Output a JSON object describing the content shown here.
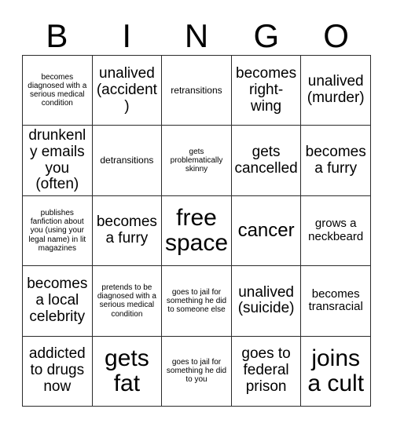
{
  "card": {
    "header_letters": [
      "B",
      "I",
      "N",
      "G",
      "O"
    ],
    "ink_color": "#000000",
    "grid_line_color": "#2b2b2b",
    "background_color": "#ffffff",
    "rows": [
      [
        {
          "text": "becomes diagnosed with a serious medical condition",
          "size": "xs"
        },
        {
          "text": "unalived (accident)",
          "size": "l"
        },
        {
          "text": "retransitions",
          "size": "s"
        },
        {
          "text": "becomes right-wing",
          "size": "l"
        },
        {
          "text": "unalived (murder)",
          "size": "l"
        }
      ],
      [
        {
          "text": "drunkenly emails you (often)",
          "size": "l"
        },
        {
          "text": "detransitions",
          "size": "s"
        },
        {
          "text": "gets problematically skinny",
          "size": "xs"
        },
        {
          "text": "gets cancelled",
          "size": "l"
        },
        {
          "text": "becomes a furry",
          "size": "l"
        }
      ],
      [
        {
          "text": "publishes fanfiction about you (using your legal name) in lit magazines",
          "size": "xs"
        },
        {
          "text": "becomes a furry",
          "size": "l"
        },
        {
          "text": "free space",
          "size": "xxl"
        },
        {
          "text": "cancer",
          "size": "xl"
        },
        {
          "text": "grows a neckbeard",
          "size": "m"
        }
      ],
      [
        {
          "text": "becomes a local celebrity",
          "size": "l"
        },
        {
          "text": "pretends to be diagnosed with a serious medical condition",
          "size": "xs"
        },
        {
          "text": "goes to jail for something he did to someone else",
          "size": "xs"
        },
        {
          "text": "unalived (suicide)",
          "size": "l"
        },
        {
          "text": "becomes transracial",
          "size": "m"
        }
      ],
      [
        {
          "text": "addicted to drugs now",
          "size": "l"
        },
        {
          "text": "gets fat",
          "size": "xxl"
        },
        {
          "text": "goes to jail for something he did to you",
          "size": "xs"
        },
        {
          "text": "goes to federal prison",
          "size": "l"
        },
        {
          "text": "joins a cult",
          "size": "xxl"
        }
      ]
    ]
  }
}
